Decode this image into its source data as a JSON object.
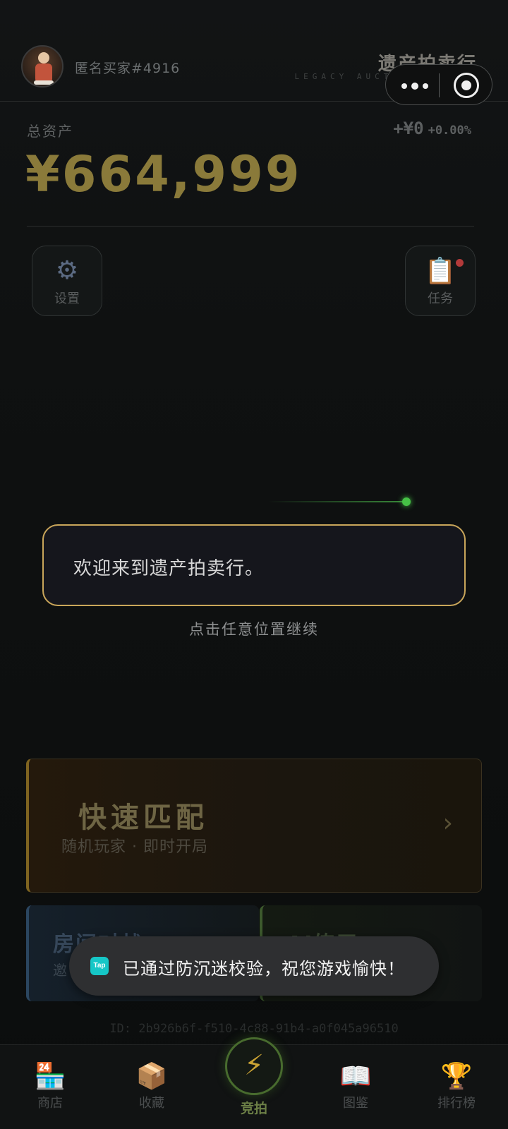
{
  "header": {
    "username": "匿名买家#4916",
    "brand_title": "遗产拍卖行",
    "brand_subtitle": "LEGACY AUCTION HOUSE"
  },
  "assets": {
    "label": "总资产",
    "value": "¥664,999",
    "change": "+¥0",
    "change_pct": "+0.00%"
  },
  "corner_buttons": {
    "settings": {
      "icon": "gear-icon",
      "label": "设置"
    },
    "tasks": {
      "icon": "clipboard-icon",
      "label": "任务",
      "has_notification": true
    }
  },
  "tutorial": {
    "dialog_text": "欢迎来到遗产拍卖行。",
    "continue_hint": "点击任意位置继续"
  },
  "quick_match": {
    "title": "快速匹配",
    "subtitle": "随机玩家 · 即时开局",
    "arrow": "›"
  },
  "cards": {
    "room": {
      "title": "房间对战",
      "subtitle": "邀"
    },
    "practice": {
      "title": "AI练习"
    }
  },
  "player_id": "ID: 2b926b6f-f510-4c88-91b4-a0f045a96510",
  "toast": {
    "logo_text": "Tap",
    "message": "已通过防沉迷校验，祝您游戏愉快！"
  },
  "nav": {
    "shop": {
      "icon": "🏪",
      "label": "商店"
    },
    "collection": {
      "icon": "📦",
      "label": "收藏"
    },
    "auction": {
      "icon": "⚡",
      "label": "竞拍"
    },
    "catalog": {
      "icon": "📖",
      "label": "图鉴"
    },
    "ranking": {
      "icon": "🏆",
      "label": "排行榜"
    }
  },
  "colors": {
    "gold": "#c9a65a",
    "green_accent": "#46c146",
    "toast_bg": "#2e2f31"
  }
}
